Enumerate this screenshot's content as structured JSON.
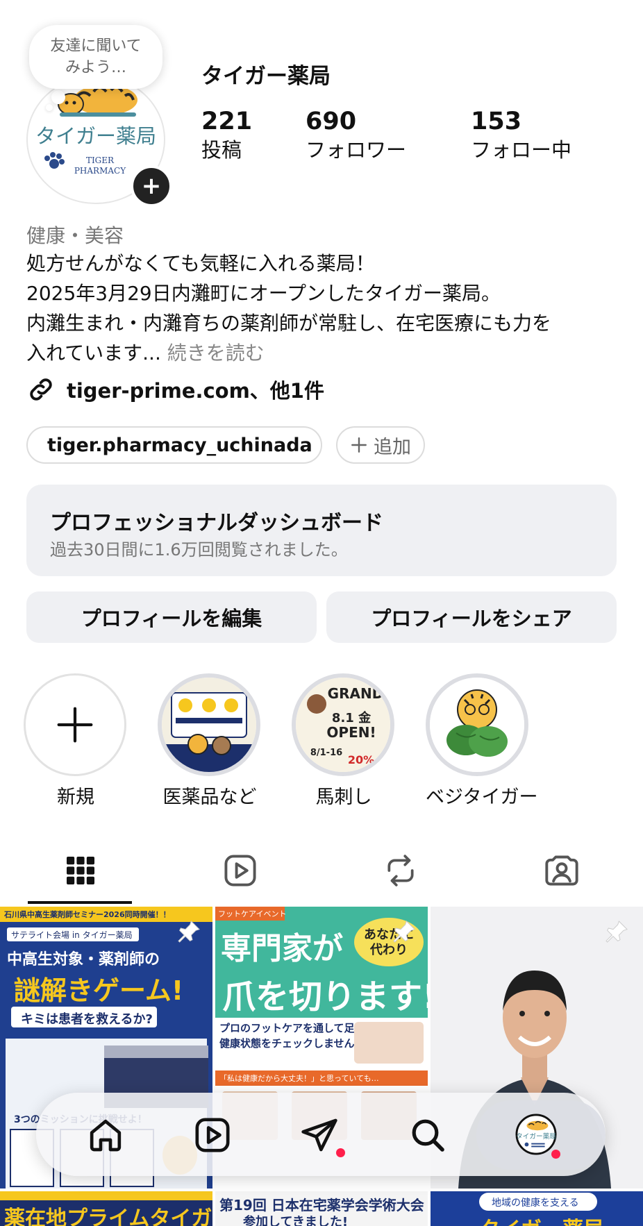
{
  "profile": {
    "note": "友達に聞いて\nみよう…",
    "username": "タイガー薬局",
    "avatar_title": "タイガー薬局",
    "avatar_en1": "TIGER",
    "avatar_en2": "PHARMACY",
    "add_story_icon": "plus-icon"
  },
  "stats": [
    {
      "value": "221",
      "label": "投稿"
    },
    {
      "value": "690",
      "label": "フォロワー"
    },
    {
      "value": "153",
      "label": "フォロー中"
    }
  ],
  "bio": {
    "category": "健康・美容",
    "lines": [
      "処方せんがなくても気軽に入れる薬局！",
      "2025年3月29日内灘町にオープンしたタイガー薬局。",
      "内灘生まれ・内灘育ちの薬剤師が常駐し、在宅医療にも力を",
      "入れています..."
    ],
    "more": " 続きを読む",
    "link": "tiger-prime.com、他1件"
  },
  "chips": {
    "threads": "tiger.pharmacy_uchinada",
    "add": "追加"
  },
  "dashboard": {
    "title": "プロフェッショナルダッシュボード",
    "subtitle": "過去30日間に1.6万回閲覧されました。"
  },
  "buttons": {
    "edit": "プロフィールを編集",
    "share": "プロフィールをシェア"
  },
  "highlights": [
    {
      "label": "新規"
    },
    {
      "label": "医薬品など"
    },
    {
      "label": "馬刺し"
    },
    {
      "label": "ベジタイガー"
    }
  ],
  "posts": {
    "p1_top": "石川県中高生薬剤師セミナー2026同時開催！！",
    "p1_sub": "サテライト会場 in タイガー薬局",
    "p1_t1": "中高生対象・薬剤師の",
    "p1_t2": "謎解きゲーム!",
    "p1_t3": "キミは患者を救えるか?",
    "p1_mission": "3つのミッションに挑戦せよ！",
    "p2_tag": "フットケアイベント",
    "p2_t1": "専門家が",
    "p2_bubble": "あなたに代わり",
    "p2_t2": "爪を切ります!",
    "p2_t3": "プロのフットケアを通して足爪の",
    "p2_t4": "健康状態をチェックしませんか?",
    "p2_banner": "「私は健康だから大丈夫！」と思っていても…",
    "p4": "薬在地プライムタイガー",
    "p5a": "第19回 日本在宅薬学会学術大会",
    "p5b": "参加してきました!",
    "p6a": "地域の健康を支える",
    "p6b": "タイガー薬局"
  },
  "highlight_text": {
    "h3a": "GRAND",
    "h3b": "8.1 金",
    "h3c": "OPEN!",
    "h3d": "8/1-16",
    "h3e": "20%"
  },
  "colors": {
    "accent_dot": "#ff1f4b",
    "teal": "#3f7f8f",
    "navy": "#1c2f6b",
    "yellow": "#f6c71e",
    "green": "#3fa98c"
  }
}
